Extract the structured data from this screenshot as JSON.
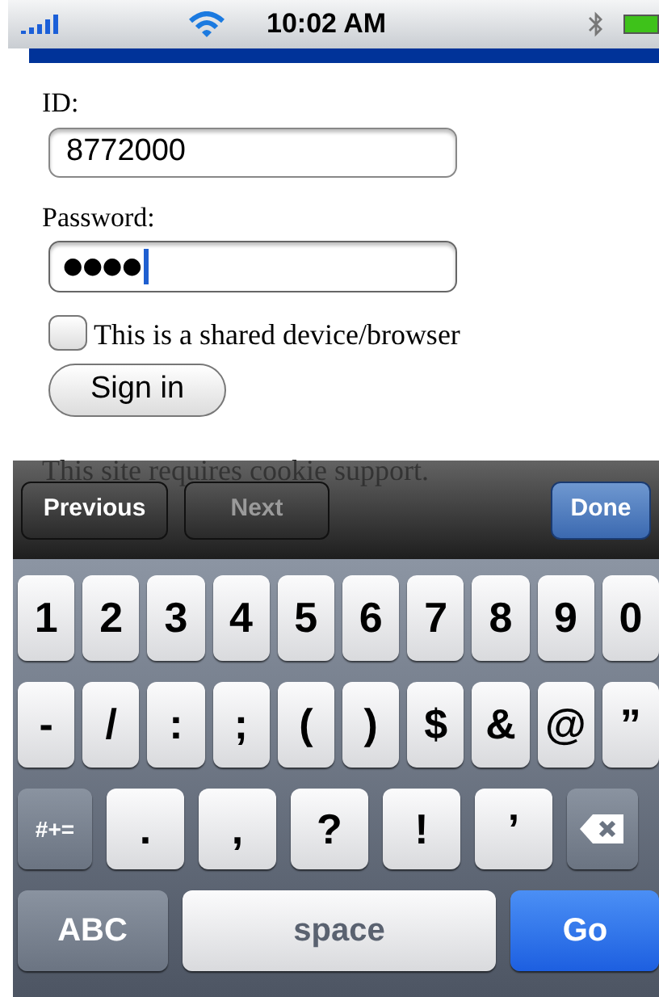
{
  "status_bar": {
    "time": "10:02 AM"
  },
  "form": {
    "id_label": "ID:",
    "id_value": "8772000",
    "password_label": "Password:",
    "password_value": "●●●●",
    "password_focused": true,
    "shared_device": {
      "label": "This is a shared device/browser",
      "checked": false
    },
    "sign_in": "Sign in",
    "notice": "This site requires cookie support."
  },
  "toolbar": {
    "previous": {
      "label": "Previous",
      "disabled": false
    },
    "next": {
      "label": "Next",
      "disabled": true
    },
    "done": "Done"
  },
  "keyboard": {
    "rows": [
      [
        {
          "kind": "char",
          "label": "1"
        },
        {
          "kind": "char",
          "label": "2"
        },
        {
          "kind": "char",
          "label": "3"
        },
        {
          "kind": "char",
          "label": "4"
        },
        {
          "kind": "char",
          "label": "5"
        },
        {
          "kind": "char",
          "label": "6"
        },
        {
          "kind": "char",
          "label": "7"
        },
        {
          "kind": "char",
          "label": "8"
        },
        {
          "kind": "char",
          "label": "9"
        },
        {
          "kind": "char",
          "label": "0"
        }
      ],
      [
        {
          "kind": "char",
          "label": "-"
        },
        {
          "kind": "char",
          "label": "/"
        },
        {
          "kind": "char",
          "label": ":"
        },
        {
          "kind": "char",
          "label": ";"
        },
        {
          "kind": "char",
          "label": "("
        },
        {
          "kind": "char",
          "label": ")"
        },
        {
          "kind": "char",
          "label": "$"
        },
        {
          "kind": "char",
          "label": "&"
        },
        {
          "kind": "char",
          "label": "@"
        },
        {
          "kind": "char",
          "label": "”"
        }
      ],
      [
        {
          "kind": "function",
          "label": "#+="
        },
        {
          "kind": "wide",
          "label": "."
        },
        {
          "kind": "wide",
          "label": ","
        },
        {
          "kind": "wide",
          "label": "?"
        },
        {
          "kind": "wide",
          "label": "!"
        },
        {
          "kind": "wide",
          "label": "’"
        },
        {
          "kind": "backspace"
        }
      ]
    ],
    "bottom_row": {
      "mode_key": "ABC",
      "space_key": "space",
      "go_key": "Go"
    }
  }
}
